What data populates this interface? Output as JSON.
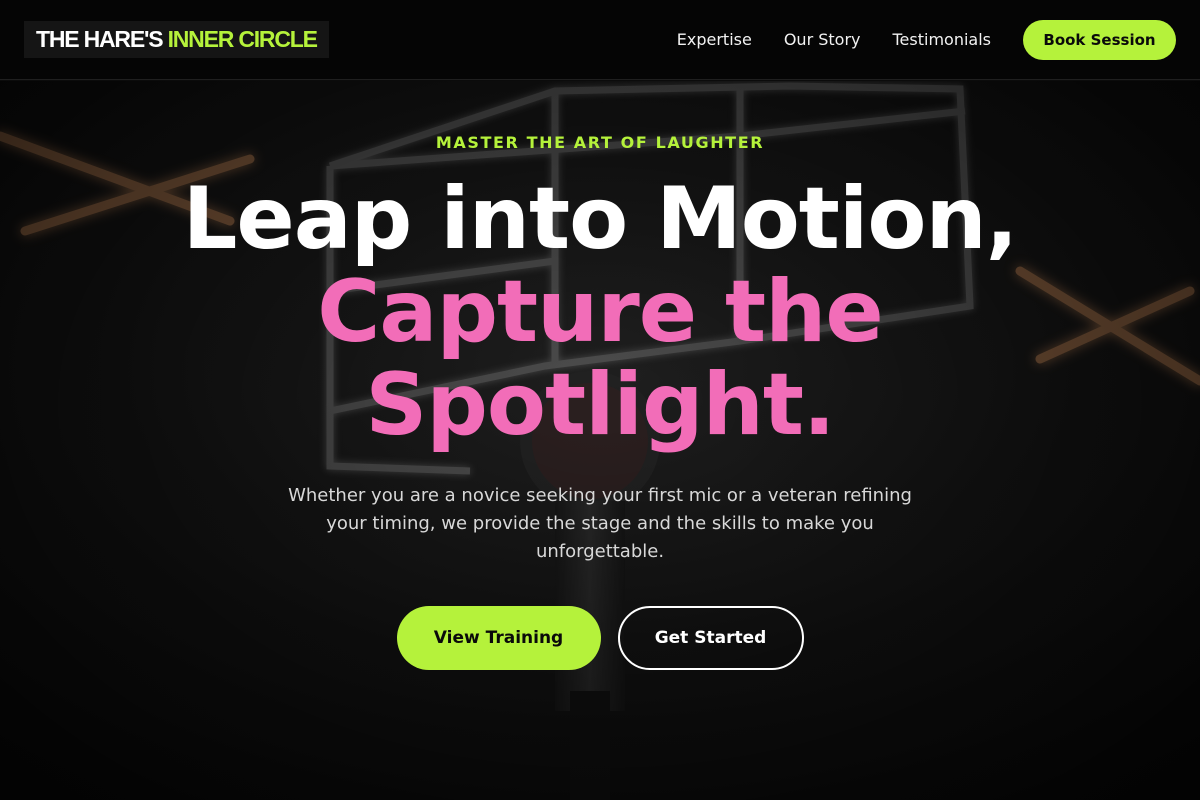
{
  "brand": {
    "name_part1": "THE HARE'S",
    "name_part2": "INNER CIRCLE"
  },
  "nav": {
    "links": [
      "Expertise",
      "Our Story",
      "Testimonials"
    ],
    "cta_label": "Book Session"
  },
  "hero": {
    "eyebrow": "MASTER THE ART OF LAUGHTER",
    "headline_line1": "Leap into Motion,",
    "headline_line2a": "Capture the",
    "headline_line2b": "Spotlight.",
    "subtext": "Whether you are a novice seeking your first mic or a veteran refining your timing, we provide the stage and the skills to make you unforgettable.",
    "primary_cta": "View Training",
    "secondary_cta": "Get Started"
  },
  "colors": {
    "accent_green": "#b5f23b",
    "accent_pink": "#f26db8",
    "background": "#0b0b0b"
  },
  "icons": [
    "microphone-backdrop",
    "neon-light-bars"
  ]
}
